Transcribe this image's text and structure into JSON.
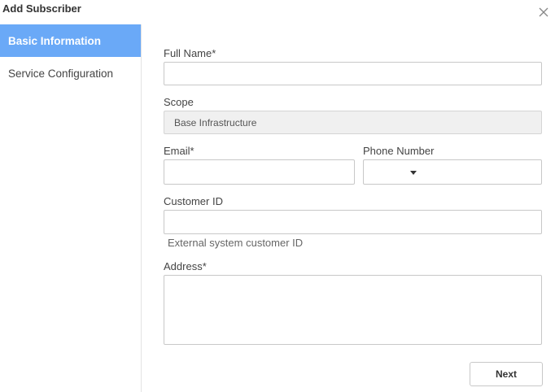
{
  "dialog": {
    "title": "Add Subscriber",
    "close_icon": "close-icon"
  },
  "sidebar": {
    "items": [
      {
        "label": "Basic Information",
        "active": true
      },
      {
        "label": "Service Configuration",
        "active": false
      }
    ]
  },
  "form": {
    "full_name": {
      "label": "Full Name*",
      "value": ""
    },
    "scope": {
      "label": "Scope",
      "value": "Base Infrastructure"
    },
    "email": {
      "label": "Email*",
      "value": ""
    },
    "phone": {
      "label": "Phone Number",
      "country_value": "",
      "number_value": ""
    },
    "customer_id": {
      "label": "Customer ID",
      "value": "",
      "hint": "External system customer ID"
    },
    "address": {
      "label": "Address*",
      "value": ""
    }
  },
  "footer": {
    "next_label": "Next"
  },
  "colors": {
    "accent": "#6aa9f7"
  }
}
